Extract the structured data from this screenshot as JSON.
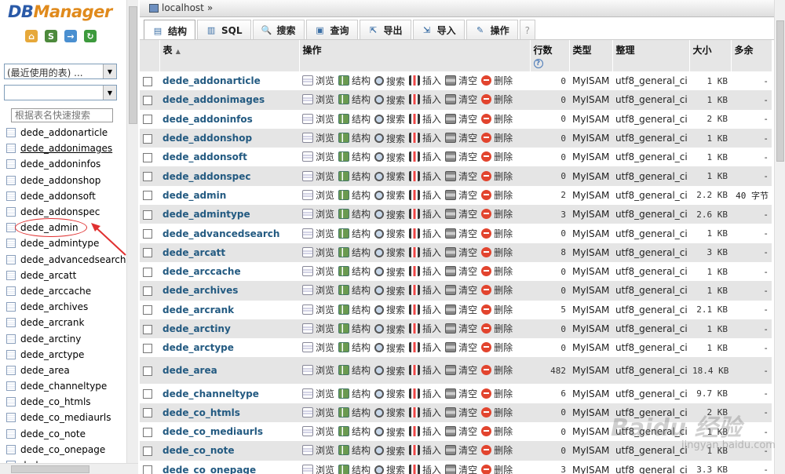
{
  "app": {
    "logo_db": "DB",
    "logo_rest": "Manager"
  },
  "sidebar": {
    "quick_icons": [
      "home-icon",
      "sql-icon",
      "export-icon",
      "reload-icon"
    ],
    "recent_tables_select": "(最近使用的表) ...",
    "database_select": "",
    "filter_placeholder": "根据表名快速搜索",
    "tables": [
      "dede_addonarticle",
      "dede_addonimages",
      "dede_addoninfos",
      "dede_addonshop",
      "dede_addonsoft",
      "dede_addonspec",
      "dede_admin",
      "dede_admintype",
      "dede_advancedsearch",
      "dede_arcatt",
      "dede_arccache",
      "dede_archives",
      "dede_arcrank",
      "dede_arctiny",
      "dede_arctype",
      "dede_area",
      "dede_channeltype",
      "dede_co_htmls",
      "dede_co_mediaurls",
      "dede_co_note",
      "dede_co_onepage",
      "dede_co_..."
    ]
  },
  "breadcrumb": {
    "server": "localhost",
    "sep": "»"
  },
  "tabs": [
    {
      "label": "结构",
      "icon": "structure-icon"
    },
    {
      "label": "SQL",
      "icon": "sql-icon"
    },
    {
      "label": "搜索",
      "icon": "search-icon"
    },
    {
      "label": "查询",
      "icon": "query-icon"
    },
    {
      "label": "导出",
      "icon": "export-icon"
    },
    {
      "label": "导入",
      "icon": "import-icon"
    },
    {
      "label": "操作",
      "icon": "wrench-icon"
    },
    {
      "label": "?",
      "icon": "help-icon"
    }
  ],
  "columns": {
    "table": "表",
    "action": "操作",
    "rows": "行数",
    "type": "类型",
    "collation": "整理",
    "size": "大小",
    "overhead": "多余"
  },
  "actions": {
    "browse": "浏览",
    "structure": "结构",
    "search": "搜索",
    "insert": "插入",
    "empty": "清空",
    "drop": "删除"
  },
  "rows": [
    {
      "name": "dede_addonarticle",
      "rows": "0",
      "type": "MyISAM",
      "collation": "utf8_general_ci",
      "size": "1 KB",
      "overhead": "-"
    },
    {
      "name": "dede_addonimages",
      "rows": "0",
      "type": "MyISAM",
      "collation": "utf8_general_ci",
      "size": "1 KB",
      "overhead": "-"
    },
    {
      "name": "dede_addoninfos",
      "rows": "0",
      "type": "MyISAM",
      "collation": "utf8_general_ci",
      "size": "2 KB",
      "overhead": "-"
    },
    {
      "name": "dede_addonshop",
      "rows": "0",
      "type": "MyISAM",
      "collation": "utf8_general_ci",
      "size": "1 KB",
      "overhead": "-"
    },
    {
      "name": "dede_addonsoft",
      "rows": "0",
      "type": "MyISAM",
      "collation": "utf8_general_ci",
      "size": "1 KB",
      "overhead": "-"
    },
    {
      "name": "dede_addonspec",
      "rows": "0",
      "type": "MyISAM",
      "collation": "utf8_general_ci",
      "size": "1 KB",
      "overhead": "-"
    },
    {
      "name": "dede_admin",
      "rows": "2",
      "type": "MyISAM",
      "collation": "utf8_general_ci",
      "size": "2.2 KB",
      "overhead": "40 字节"
    },
    {
      "name": "dede_admintype",
      "rows": "3",
      "type": "MyISAM",
      "collation": "utf8_general_ci",
      "size": "2.6 KB",
      "overhead": "-"
    },
    {
      "name": "dede_advancedsearch",
      "rows": "0",
      "type": "MyISAM",
      "collation": "utf8_general_ci",
      "size": "1 KB",
      "overhead": "-"
    },
    {
      "name": "dede_arcatt",
      "rows": "8",
      "type": "MyISAM",
      "collation": "utf8_general_ci",
      "size": "3 KB",
      "overhead": "-"
    },
    {
      "name": "dede_arccache",
      "rows": "0",
      "type": "MyISAM",
      "collation": "utf8_general_ci",
      "size": "1 KB",
      "overhead": "-"
    },
    {
      "name": "dede_archives",
      "rows": "0",
      "type": "MyISAM",
      "collation": "utf8_general_ci",
      "size": "1 KB",
      "overhead": "-"
    },
    {
      "name": "dede_arcrank",
      "rows": "5",
      "type": "MyISAM",
      "collation": "utf8_general_ci",
      "size": "2.1 KB",
      "overhead": "-"
    },
    {
      "name": "dede_arctiny",
      "rows": "0",
      "type": "MyISAM",
      "collation": "utf8_general_ci",
      "size": "1 KB",
      "overhead": "-"
    },
    {
      "name": "dede_arctype",
      "rows": "0",
      "type": "MyISAM",
      "collation": "utf8_general_ci",
      "size": "1 KB",
      "overhead": "-"
    },
    {
      "name": "dede_area",
      "rows": "482",
      "type": "MyISAM",
      "collation": "utf8_general_ci",
      "size": "18.4 KB",
      "overhead": "-"
    },
    {
      "name": "dede_channeltype",
      "rows": "6",
      "type": "MyISAM",
      "collation": "utf8_general_ci",
      "size": "9.7 KB",
      "overhead": "-"
    },
    {
      "name": "dede_co_htmls",
      "rows": "0",
      "type": "MyISAM",
      "collation": "utf8_general_ci",
      "size": "2 KB",
      "overhead": "-"
    },
    {
      "name": "dede_co_mediaurls",
      "rows": "0",
      "type": "MyISAM",
      "collation": "utf8_general_ci",
      "size": "1 KB",
      "overhead": "-"
    },
    {
      "name": "dede_co_note",
      "rows": "0",
      "type": "MyISAM",
      "collation": "utf8_general_ci",
      "size": "1 KB",
      "overhead": "-"
    },
    {
      "name": "dede_co_onepage",
      "rows": "3",
      "type": "MyISAM",
      "collation": "utf8_general_ci",
      "size": "3.3 KB",
      "overhead": "-"
    }
  ],
  "watermark": {
    "main": "Baidu 经验",
    "sub": "jingyan.baidu.com"
  }
}
